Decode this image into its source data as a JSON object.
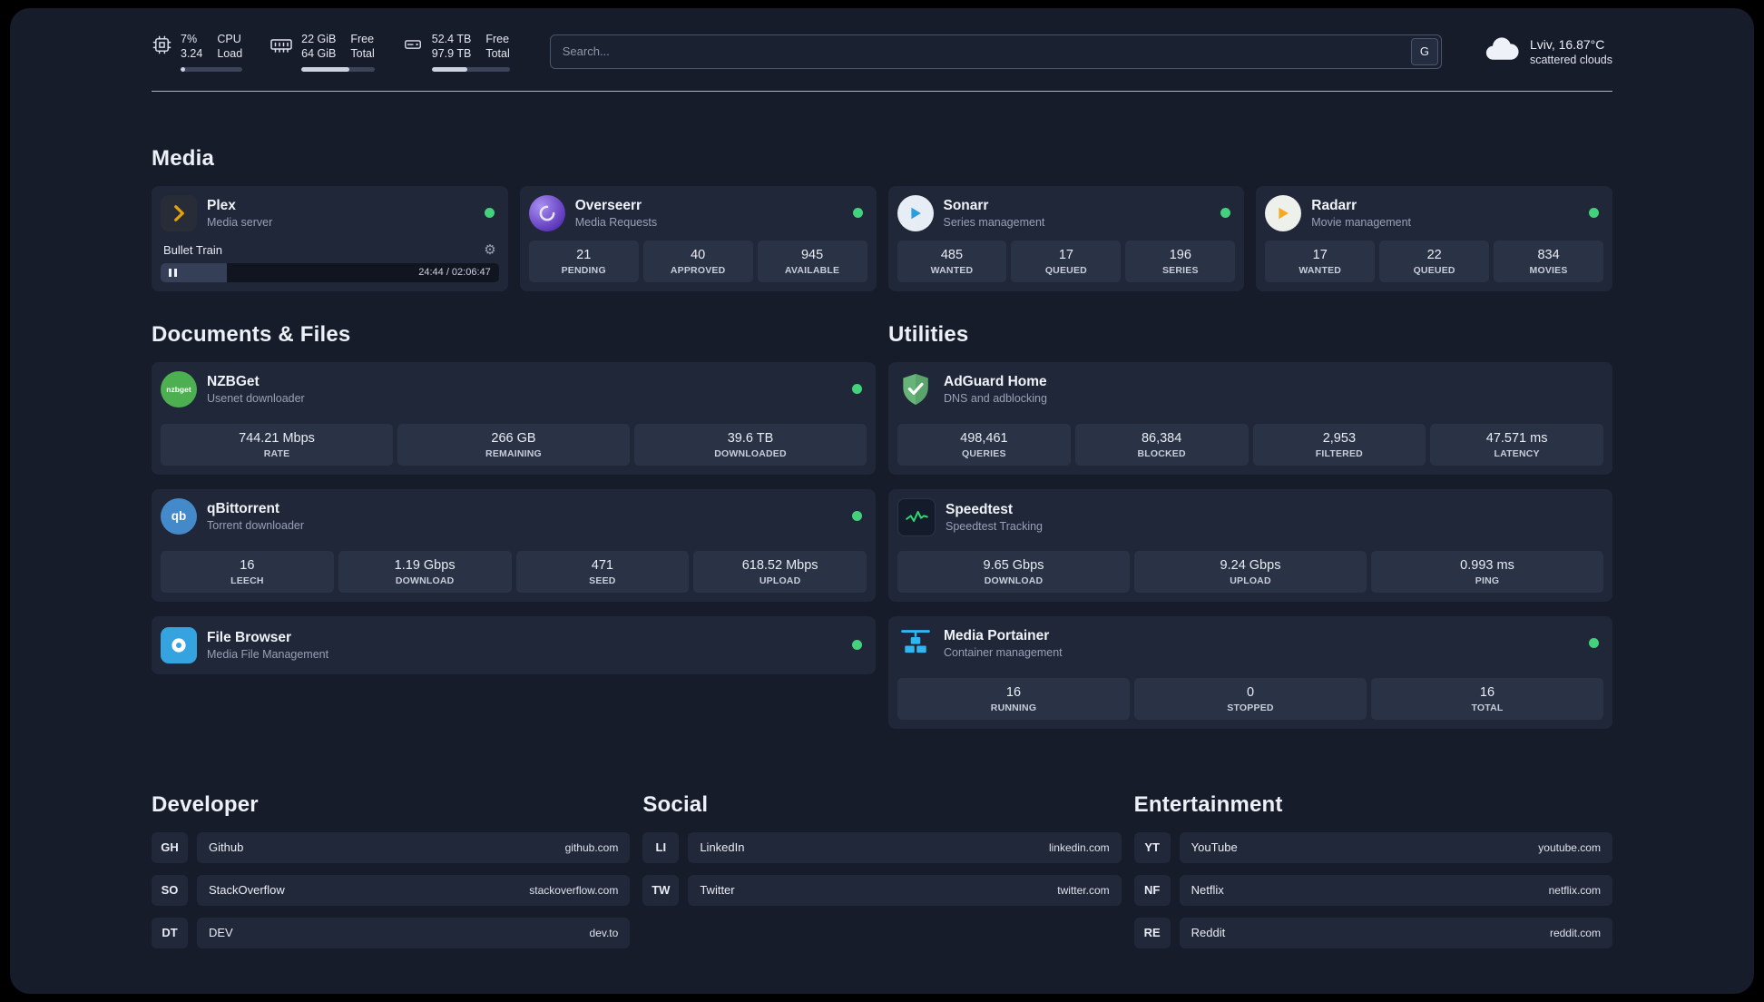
{
  "header": {
    "cpu": {
      "value_top": "7%",
      "value_bottom": "3.24",
      "label_top": "CPU",
      "label_bottom": "Load",
      "bar_percent": 7
    },
    "ram": {
      "value_top": "22 GiB",
      "value_bottom": "64 GiB",
      "label_top": "Free",
      "label_bottom": "Total",
      "bar_percent": 66
    },
    "disk": {
      "value_top": "52.4 TB",
      "value_bottom": "97.9 TB",
      "label_top": "Free",
      "label_bottom": "Total",
      "bar_percent": 46
    },
    "search": {
      "placeholder": "Search...",
      "engine_label": "G"
    },
    "weather": {
      "location": "Lviv, 16.87°C",
      "condition": "scattered clouds"
    }
  },
  "media": {
    "title": "Media",
    "plex": {
      "name": "Plex",
      "subtitle": "Media server",
      "status": "online",
      "now_playing": "Bullet Train",
      "time": "24:44 / 02:06:47",
      "progress_percent": 19.5
    },
    "overseerr": {
      "name": "Overseerr",
      "subtitle": "Media Requests",
      "status": "online",
      "stats": [
        {
          "value": "21",
          "label": "PENDING"
        },
        {
          "value": "40",
          "label": "APPROVED"
        },
        {
          "value": "945",
          "label": "AVAILABLE"
        }
      ]
    },
    "sonarr": {
      "name": "Sonarr",
      "subtitle": "Series management",
      "status": "online",
      "stats": [
        {
          "value": "485",
          "label": "WANTED"
        },
        {
          "value": "17",
          "label": "QUEUED"
        },
        {
          "value": "196",
          "label": "SERIES"
        }
      ]
    },
    "radarr": {
      "name": "Radarr",
      "subtitle": "Movie management",
      "status": "online",
      "stats": [
        {
          "value": "17",
          "label": "WANTED"
        },
        {
          "value": "22",
          "label": "QUEUED"
        },
        {
          "value": "834",
          "label": "MOVIES"
        }
      ]
    }
  },
  "documents": {
    "title": "Documents & Files",
    "nzbget": {
      "name": "NZBGet",
      "subtitle": "Usenet downloader",
      "status": "online",
      "icon_text": "nzbget",
      "stats": [
        {
          "value": "744.21 Mbps",
          "label": "RATE"
        },
        {
          "value": "266 GB",
          "label": "REMAINING"
        },
        {
          "value": "39.6 TB",
          "label": "DOWNLOADED"
        }
      ]
    },
    "qbittorrent": {
      "name": "qBittorrent",
      "subtitle": "Torrent downloader",
      "status": "online",
      "icon_text": "qb",
      "stats": [
        {
          "value": "16",
          "label": "LEECH"
        },
        {
          "value": "1.19 Gbps",
          "label": "DOWNLOAD"
        },
        {
          "value": "471",
          "label": "SEED"
        },
        {
          "value": "618.52 Mbps",
          "label": "UPLOAD"
        }
      ]
    },
    "filebrowser": {
      "name": "File Browser",
      "subtitle": "Media File Management",
      "status": "online"
    }
  },
  "utilities": {
    "title": "Utilities",
    "adguard": {
      "name": "AdGuard Home",
      "subtitle": "DNS and adblocking",
      "stats": [
        {
          "value": "498,461",
          "label": "QUERIES"
        },
        {
          "value": "86,384",
          "label": "BLOCKED"
        },
        {
          "value": "2,953",
          "label": "FILTERED"
        },
        {
          "value": "47.571 ms",
          "label": "LATENCY"
        }
      ]
    },
    "speedtest": {
      "name": "Speedtest",
      "subtitle": "Speedtest Tracking",
      "stats": [
        {
          "value": "9.65 Gbps",
          "label": "DOWNLOAD"
        },
        {
          "value": "9.24 Gbps",
          "label": "UPLOAD"
        },
        {
          "value": "0.993 ms",
          "label": "PING"
        }
      ]
    },
    "portainer": {
      "name": "Media Portainer",
      "subtitle": "Container management",
      "status": "online",
      "stats": [
        {
          "value": "16",
          "label": "RUNNING"
        },
        {
          "value": "0",
          "label": "STOPPED"
        },
        {
          "value": "16",
          "label": "TOTAL"
        }
      ]
    }
  },
  "links": {
    "developer": {
      "title": "Developer",
      "items": [
        {
          "abbr": "GH",
          "name": "Github",
          "url": "github.com"
        },
        {
          "abbr": "SO",
          "name": "StackOverflow",
          "url": "stackoverflow.com"
        },
        {
          "abbr": "DT",
          "name": "DEV",
          "url": "dev.to"
        }
      ]
    },
    "social": {
      "title": "Social",
      "items": [
        {
          "abbr": "LI",
          "name": "LinkedIn",
          "url": "linkedin.com"
        },
        {
          "abbr": "TW",
          "name": "Twitter",
          "url": "twitter.com"
        }
      ]
    },
    "entertainment": {
      "title": "Entertainment",
      "items": [
        {
          "abbr": "YT",
          "name": "YouTube",
          "url": "youtube.com"
        },
        {
          "abbr": "NF",
          "name": "Netflix",
          "url": "netflix.com"
        },
        {
          "abbr": "RE",
          "name": "Reddit",
          "url": "reddit.com"
        }
      ]
    }
  },
  "colors": {
    "status_online": "#43d17c",
    "plex_accent": "#e5a00d",
    "overseerr_accent": "#6d45cf",
    "sonarr_accent": "#2d9cdb",
    "radarr_accent": "#f6a821",
    "nzbget_accent": "#4caf50",
    "qbittorrent_accent": "#4489c9",
    "filebrowser_accent": "#35a3e0",
    "adguard_accent": "#67b47a",
    "speedtest_accent": "#2fd573",
    "portainer_accent": "#30b6f0"
  }
}
